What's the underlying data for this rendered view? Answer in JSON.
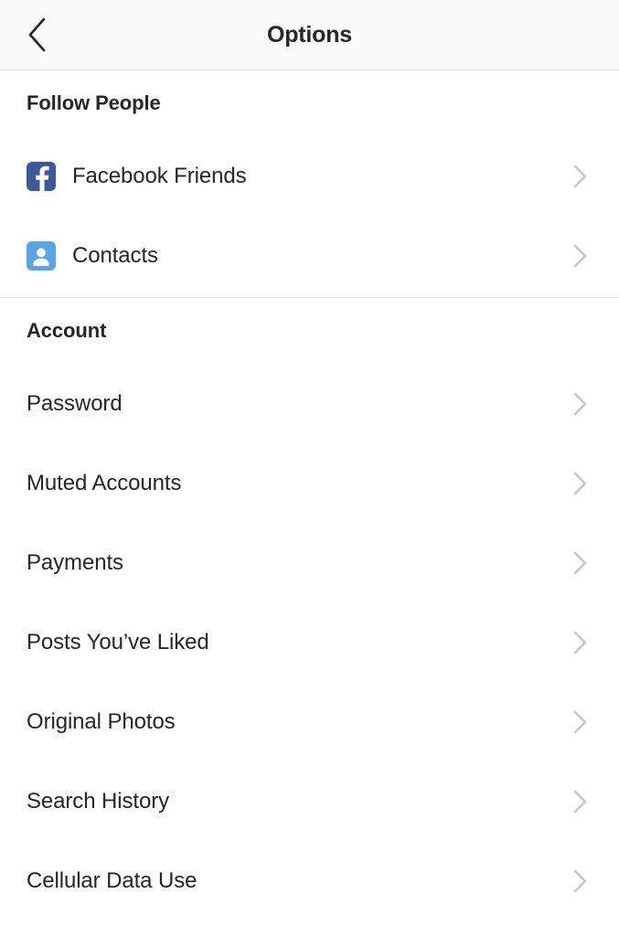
{
  "header": {
    "title": "Options",
    "back_icon": "chevron-left-icon",
    "back_label": "Back"
  },
  "colors": {
    "facebook_blue": "#3b5998",
    "contacts_blue": "#5ba4e5",
    "text": "#262626",
    "chevron": "#c7c7cc",
    "divider": "#dbdbdb",
    "navbar_bg": "#fafafa",
    "page_bg": "#ffffff"
  },
  "sections": [
    {
      "id": "follow",
      "title": "Follow People",
      "rows": [
        {
          "label": "Facebook Friends",
          "icon": "facebook-icon",
          "chevron": "chevron-right-icon"
        },
        {
          "label": "Contacts",
          "icon": "contacts-person-icon",
          "chevron": "chevron-right-icon"
        }
      ]
    },
    {
      "id": "account",
      "title": "Account",
      "rows": [
        {
          "label": "Password",
          "icon": null,
          "chevron": "chevron-right-icon"
        },
        {
          "label": "Muted Accounts",
          "icon": null,
          "chevron": "chevron-right-icon"
        },
        {
          "label": "Payments",
          "icon": null,
          "chevron": "chevron-right-icon"
        },
        {
          "label": "Posts You’ve Liked",
          "icon": null,
          "chevron": "chevron-right-icon"
        },
        {
          "label": "Original Photos",
          "icon": null,
          "chevron": "chevron-right-icon"
        },
        {
          "label": "Search History",
          "icon": null,
          "chevron": "chevron-right-icon"
        },
        {
          "label": "Cellular Data Use",
          "icon": null,
          "chevron": "chevron-right-icon"
        }
      ]
    }
  ]
}
